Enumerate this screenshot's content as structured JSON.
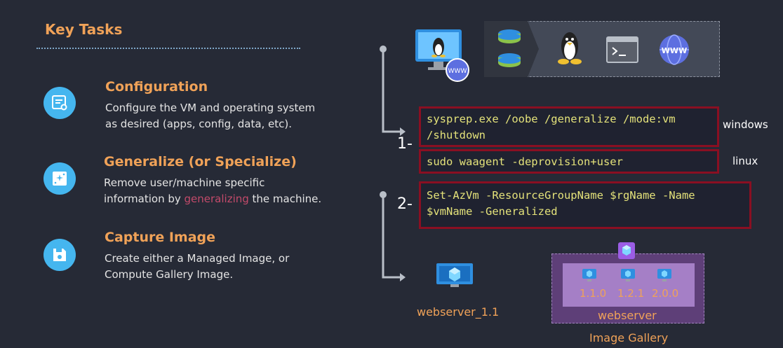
{
  "header": {
    "title": "Key Tasks"
  },
  "tasks": [
    {
      "heading": "Configuration",
      "body_line1": "Configure the VM and operating system",
      "body_line2": "as desired (apps, config, data, etc)."
    },
    {
      "heading": "Generalize  (or Specialize)",
      "body_line1": "Remove user/machine specific",
      "body_line2_pre": "information by ",
      "body_line2_highlight": "generalizing",
      "body_line2_post": " the machine."
    },
    {
      "heading": "Capture Image",
      "body_line1": "Create either a Managed Image, or",
      "body_line2": "Compute Gallery Image."
    }
  ],
  "commands": {
    "windows_line1": "sysprep.exe /oobe /generalize /mode:vm",
    "windows_line2": "/shutdown",
    "windows_label": "windows",
    "linux": "sudo waagent -deprovision+user",
    "linux_label": "linux",
    "azure_line1": "Set-AzVm -ResourceGroupName $rgName -Name",
    "azure_line2": "$vmName -Generalized"
  },
  "steps": {
    "step1": "1-",
    "step2": "2-"
  },
  "output": {
    "image_name": "webserver_1.1",
    "gallery_definition": "webserver",
    "gallery_label": "Image Gallery",
    "versions": [
      "1.1.0",
      "1.2.1",
      "2.0.0"
    ]
  },
  "icons": {
    "vm": "vm-monitor-linux-icon",
    "www": "www-globe-icon",
    "disks": "disk-stack-icon",
    "linux": "linux-penguin-icon",
    "terminal": "terminal-icon",
    "image": "vm-image-icon",
    "gallery": "gallery-icon"
  },
  "colors": {
    "accent": "#f0a258",
    "code_border": "#8a0f22",
    "code_text": "#e4e27a",
    "icon_blue": "#45b6ef",
    "highlight": "#c24a6a",
    "gallery": "#5e3f78"
  }
}
